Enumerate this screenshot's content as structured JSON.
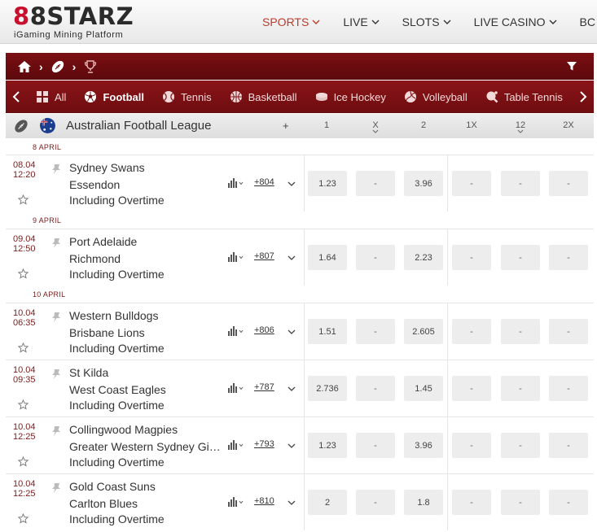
{
  "brand": {
    "logo_prefix_1": "8",
    "logo_prefix_2": "8",
    "logo_name": "STARZ",
    "tagline": "iGaming Mining Platform",
    "accent_color": "#c8102e"
  },
  "main_nav": [
    {
      "label": "SPORTS",
      "active": true
    },
    {
      "label": "LIVE",
      "active": false
    },
    {
      "label": "SLOTS",
      "active": false
    },
    {
      "label": "LIVE CASINO",
      "active": false
    },
    {
      "label": "BC",
      "active": false
    }
  ],
  "breadcrumb": {
    "icons": [
      "home-icon",
      "football-icon",
      "trophy-icon"
    ],
    "filter_icon": "filter-icon"
  },
  "sports_tabs": [
    {
      "label": "All",
      "icon": "grid-icon",
      "active": false
    },
    {
      "label": "Football",
      "icon": "soccer-ball-icon",
      "active": true
    },
    {
      "label": "Tennis",
      "icon": "tennis-ball-icon",
      "active": false
    },
    {
      "label": "Basketball",
      "icon": "basketball-icon",
      "active": false
    },
    {
      "label": "Ice Hockey",
      "icon": "hockey-puck-icon",
      "active": false
    },
    {
      "label": "Volleyball",
      "icon": "volleyball-icon",
      "active": false
    },
    {
      "label": "Table Tennis",
      "icon": "table-tennis-icon",
      "active": false
    }
  ],
  "league": {
    "title": "Australian Football League",
    "plus": "+",
    "columns": [
      {
        "label": "1",
        "caret": false
      },
      {
        "label": "X",
        "caret": true
      },
      {
        "label": "2",
        "caret": false
      },
      {
        "label": "1X",
        "caret": false
      },
      {
        "label": "12",
        "caret": true
      },
      {
        "label": "2X",
        "caret": false
      }
    ]
  },
  "date_groups": [
    {
      "label": "8 APRIL"
    },
    {
      "label": "9 APRIL"
    },
    {
      "label": "10 APRIL"
    }
  ],
  "events": [
    {
      "date": "08.04",
      "time": "12:20",
      "team1": "Sydney Swans",
      "team2": "Essendon",
      "note": "Including Overtime",
      "markets": "+804",
      "odds": [
        "1.23",
        "-",
        "3.96",
        "-",
        "-",
        "-"
      ]
    },
    {
      "date": "09.04",
      "time": "12:50",
      "team1": "Port Adelaide",
      "team2": "Richmond",
      "note": "Including Overtime",
      "markets": "+807",
      "odds": [
        "1.64",
        "-",
        "2.23",
        "-",
        "-",
        "-"
      ]
    },
    {
      "date": "10.04",
      "time": "06:35",
      "team1": "Western Bulldogs",
      "team2": "Brisbane Lions",
      "note": "Including Overtime",
      "markets": "+806",
      "odds": [
        "1.51",
        "-",
        "2.605",
        "-",
        "-",
        "-"
      ]
    },
    {
      "date": "10.04",
      "time": "09:35",
      "team1": "St Kilda",
      "team2": "West Coast Eagles",
      "note": "Including Overtime",
      "markets": "+787",
      "odds": [
        "2.736",
        "-",
        "1.45",
        "-",
        "-",
        "-"
      ]
    },
    {
      "date": "10.04",
      "time": "12:25",
      "team1": "Collingwood Magpies",
      "team2": "Greater Western Sydney Giants",
      "note": "Including Overtime",
      "markets": "+793",
      "odds": [
        "1.23",
        "-",
        "3.96",
        "-",
        "-",
        "-"
      ]
    },
    {
      "date": "10.04",
      "time": "12:25",
      "team1": "Gold Coast Suns",
      "team2": "Carlton Blues",
      "note": "Including Overtime",
      "markets": "+810",
      "odds": [
        "2",
        "-",
        "1.8",
        "-",
        "-",
        "-"
      ]
    }
  ]
}
